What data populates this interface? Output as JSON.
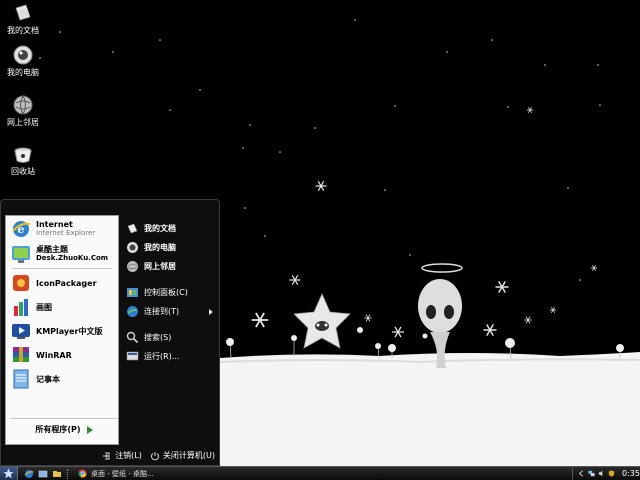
{
  "desktop": {
    "icons": [
      {
        "label": "我的文档"
      },
      {
        "label": "我的电脑"
      },
      {
        "label": "网上邻居"
      },
      {
        "label": "回收站"
      }
    ]
  },
  "start_menu": {
    "pinned": [
      {
        "label": "Internet",
        "sub": "Internet Explorer",
        "icon": "ie-icon"
      },
      {
        "label": "桌酷主题",
        "sub": "Desk.ZhuoKu.Com",
        "icon": "zhuoku-theme-icon"
      }
    ],
    "recent": [
      {
        "label": "IconPackager",
        "icon": "iconpackager-icon"
      },
      {
        "label": "画图",
        "icon": "paint-icon"
      },
      {
        "label": "KMPlayer中文版",
        "icon": "kmplayer-icon"
      },
      {
        "label": "WinRAR",
        "icon": "winrar-icon"
      },
      {
        "label": "记事本",
        "icon": "notepad-icon"
      }
    ],
    "all_programs": "所有程序(P)",
    "places": [
      {
        "label": "我的文档",
        "icon": "documents-icon"
      },
      {
        "label": "我的电脑",
        "icon": "computer-icon"
      },
      {
        "label": "网上邻居",
        "icon": "network-icon"
      },
      {
        "label": "控制面板(C)",
        "icon": "control-panel-icon"
      },
      {
        "label": "连接到(T)",
        "icon": "connect-icon"
      },
      {
        "label": "搜索(S)",
        "icon": "search-icon"
      },
      {
        "label": "运行(R)...",
        "icon": "run-icon"
      }
    ],
    "logoff": "注销(L)",
    "shutdown": "关闭计算机(U)"
  },
  "taskbar": {
    "task_title": "桌面 - 壁纸 - 桌酷...",
    "clock": "0:35"
  },
  "colors": {
    "desktop_bg": "#000000",
    "snow": "#ffffff",
    "menu_bg": "#0e0e0e",
    "menu_left_bg": "#fafafa"
  }
}
